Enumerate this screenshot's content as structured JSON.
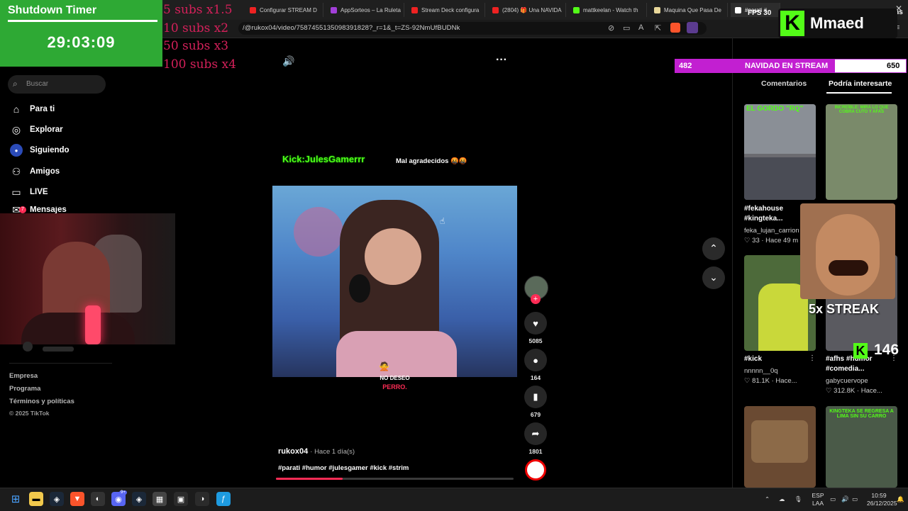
{
  "browser": {
    "tabs": [
      {
        "label": "Configurar STREAM D",
        "favicon": "youtube-icon",
        "color": "#e22"
      },
      {
        "label": "AppSorteos – La Ruleta",
        "favicon": "appsorteos-icon",
        "color": "#a23fd8"
      },
      {
        "label": "Stream Deck configura",
        "favicon": "youtube-icon",
        "color": "#e22"
      },
      {
        "label": "(2804) 🎁 Una NAVIDA",
        "favicon": "youtube-icon",
        "color": "#e22"
      },
      {
        "label": "mattkeelan - Watch th",
        "favicon": "kick-icon",
        "color": "#53fc18"
      },
      {
        "label": "Maquina Que Pasa De",
        "favicon": "gem-icon",
        "color": "#e8d79a"
      },
      {
        "label": "#parati #",
        "favicon": "tiktok-icon",
        "color": "#fff"
      }
    ],
    "url": "/@rukox04/video/7587455135098391828?_r=1&_t=ZS-92NmUfBUDNk"
  },
  "overlay": {
    "timer_title": "Shutdown Timer",
    "timer_value": "29:03:09",
    "subs_lines": [
      "5 subs x1.5",
      "10 subs x2",
      "50 subs x3",
      "100 subs x4"
    ],
    "kick_brand": "Mmaed",
    "goal_left": "482",
    "goal_title": "NAVIDAD EN STREAM",
    "goal_right": "650",
    "fps_label": "FPS",
    "fps_value": "30",
    "ms_value": "0 ms",
    "streak": "5x STREAK",
    "kick_count": "146"
  },
  "sidebar": {
    "search_placeholder": "Buscar",
    "items": [
      {
        "label": "Para ti",
        "icon": "home-icon"
      },
      {
        "label": "Explorar",
        "icon": "compass-icon"
      },
      {
        "label": "Siguiendo",
        "icon": "following-icon"
      },
      {
        "label": "Amigos",
        "icon": "friends-icon"
      },
      {
        "label": "LIVE",
        "icon": "live-icon"
      },
      {
        "label": "Mensajes",
        "icon": "messages-icon",
        "badge": "7"
      }
    ],
    "footer": [
      "Empresa",
      "Programa",
      "Términos y políticas",
      "© 2025 TikTok"
    ]
  },
  "video": {
    "overlay_tag": "Kick:JulesGamerrr",
    "overlay_text": "Mal agradecidos 🤬🤬",
    "subtitle_line1": "NO DESEO",
    "subtitle_line2": "PERRO.",
    "author": "rukox04",
    "time": "· Hace 1 día(s)",
    "hashtags": "#parati #humor #julesgamer #kick #strim",
    "likes": "5085",
    "comments": "164",
    "saves": "679",
    "shares": "1801",
    "progress": 0.28
  },
  "right_panel": {
    "tab_comments": "Comentarios",
    "tab_interest": "Podría interesarte",
    "cards": [
      {
        "caption": "#fekahouse #kingteka...",
        "author": "feka_lujan_carrion",
        "likes": "33",
        "time": "· Hace 49 m",
        "thumb_text": "EL GORDO \"RQ\""
      },
      {
        "caption": "",
        "author": "",
        "likes": "",
        "time": "",
        "thumb_text": "INCREÍBLE: MIRA LO QUE COBRA CUTO Y AFAS"
      },
      {
        "caption": "#kick",
        "author": "nnnnn__0q",
        "likes": "81.1K",
        "time": "· Hace...",
        "thumb_text": ""
      },
      {
        "caption": "#afhs #humor #comedia...",
        "author": "gabycuervope",
        "likes": "312.8K",
        "time": "· Hace...",
        "thumb_text": ""
      },
      {
        "caption": "",
        "author": "",
        "likes": "",
        "time": "",
        "thumb_text": ""
      },
      {
        "caption": "",
        "author": "",
        "likes": "",
        "time": "",
        "thumb_text": "KINGTEKA SE REGRESA A LIMA SIN SU CARRO"
      }
    ]
  },
  "taskbar": {
    "lang_top": "ESP",
    "lang_bottom": "LAA",
    "time": "10:59",
    "date": "26/12/2025",
    "discord_badge": "9+"
  }
}
